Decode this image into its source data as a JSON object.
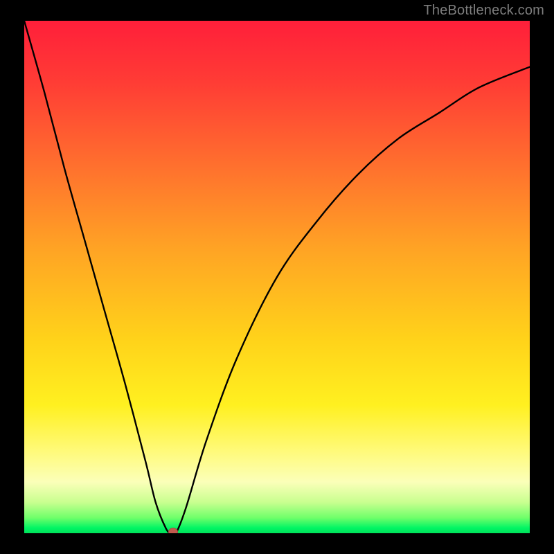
{
  "watermark": {
    "text": "TheBottleneck.com"
  },
  "chart_data": {
    "type": "line",
    "title": "",
    "xlabel": "",
    "ylabel": "",
    "xlim": [
      0,
      100
    ],
    "ylim": [
      0,
      100
    ],
    "grid": false,
    "legend": false,
    "gradient_stops": [
      {
        "pos": 0,
        "color": "#ff1f3a"
      },
      {
        "pos": 28,
        "color": "#ff6f2e"
      },
      {
        "pos": 62,
        "color": "#ffd21a"
      },
      {
        "pos": 84,
        "color": "#fffa7a"
      },
      {
        "pos": 97,
        "color": "#6fff6a"
      },
      {
        "pos": 100,
        "color": "#00e05a"
      }
    ],
    "series": [
      {
        "name": "bottleneck-curve",
        "x": [
          0,
          4,
          8,
          12,
          16,
          20,
          24,
          26,
          28,
          29,
          30,
          32,
          36,
          42,
          50,
          58,
          66,
          74,
          82,
          90,
          100
        ],
        "y": [
          100,
          86,
          71,
          57,
          43,
          29,
          14,
          6,
          1,
          0,
          0,
          5,
          18,
          34,
          50,
          61,
          70,
          77,
          82,
          87,
          91
        ]
      }
    ],
    "marker": {
      "x": 29.5,
      "y": 0,
      "color": "#c25a4e"
    }
  }
}
